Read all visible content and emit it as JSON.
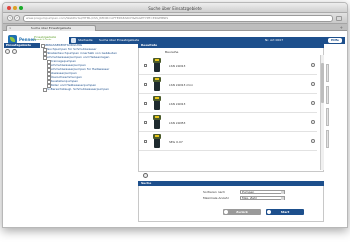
{
  "window": {
    "title": "Suche über Einsatzgebiete"
  },
  "browser": {
    "url": "www.pregumpumpen.com/WebPortal/HTML/CSS_REDIR=AFTERSEARCH&PAGETYPE=ERGEBNIS",
    "tab_label": "Suche über Einsatzgebiete"
  },
  "site": {
    "logo_text": "Pennen",
    "logo_tagline": "Einsatzgebiete",
    "logo_tagline2": "Auswahl & Suche"
  },
  "menubar": {
    "breadcrumb": "Startseite",
    "current": "Suche über Einsatzgebiete",
    "item_id": "Nr. Art 0007",
    "button": "Hilfe"
  },
  "sidebar": {
    "header": "Einsatzgebiete",
    "tree": [
      {
        "label": "ABWASSERENTSORGUNG",
        "level": 0
      },
      {
        "label": "Tauchpumpen für Schmutzwasser",
        "level": 1
      },
      {
        "label": "Fäkalientauchpumpen innerhalb von Gebäuden",
        "level": 1
      },
      {
        "label": "Schmutzwasserpumpen und Hebeanlagen",
        "level": 1
      },
      {
        "label": "Drainagepumpen",
        "level": 2
      },
      {
        "label": "Schmutzwasserpumpen",
        "level": 2
      },
      {
        "label": "Schmutzwasserpumpen für Heißwasser",
        "level": 2
      },
      {
        "label": "Abwasserpumpen",
        "level": 2
      },
      {
        "label": "Überschwemmungen",
        "level": 2
      },
      {
        "label": "Baustellenpumpen",
        "level": 2
      },
      {
        "label": "Bäder und Heißwasserpumpen",
        "level": 2
      },
      {
        "label": "Ex-Bereichstaugl. Schmutzwasserpumpen",
        "level": 1
      }
    ]
  },
  "results": {
    "header": "Resultate",
    "column": "Baureihe",
    "items": [
      {
        "name": "LSN LSN13"
      },
      {
        "name": "LSN LSN13 mini"
      },
      {
        "name": "LSN LSN13"
      },
      {
        "name": "LSN LSN53"
      },
      {
        "name": "SEG 0.07"
      }
    ]
  },
  "search": {
    "header": "Suche",
    "fields": [
      {
        "label": "Sortieren nach",
        "value": "Pumpen"
      },
      {
        "label": "Maximale Anzahl",
        "value": "Max. Zahl"
      }
    ],
    "reset_label": "Zurück",
    "go_label": "Start"
  },
  "colors": {
    "brand_blue": "#1d4f8c",
    "brand_green": "#8ec641",
    "pump_yellow": "#e7c51c"
  }
}
